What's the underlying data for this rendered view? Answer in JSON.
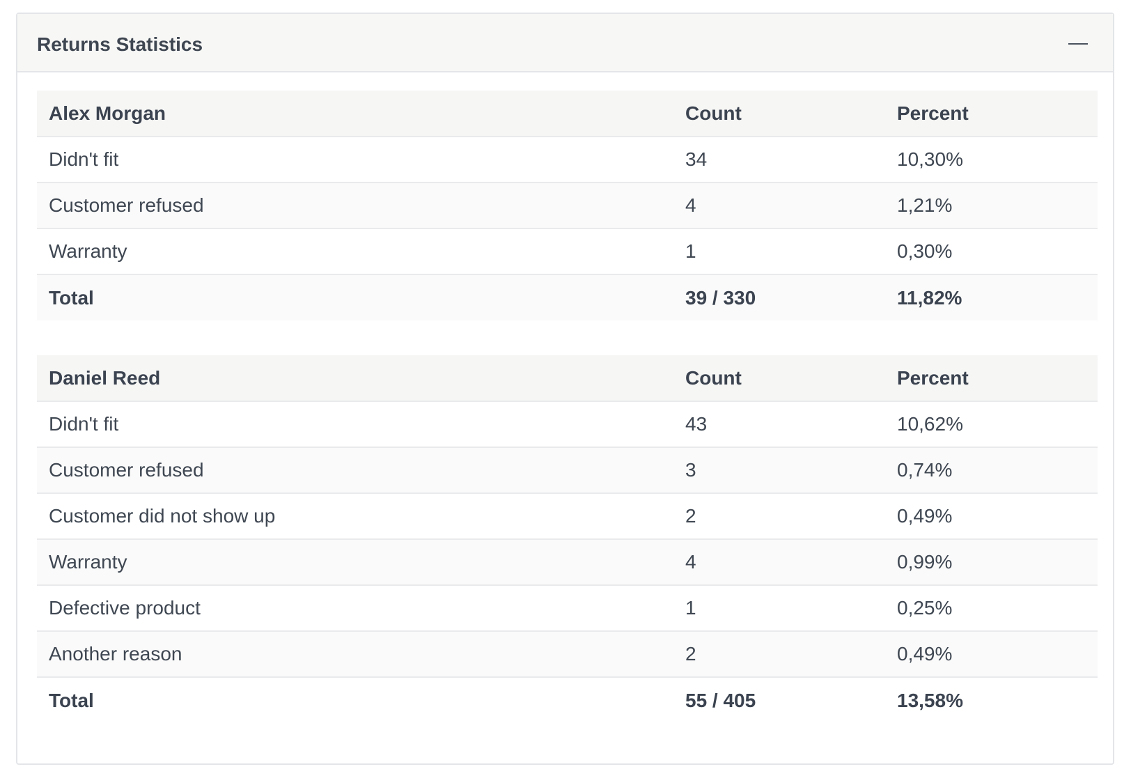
{
  "panel": {
    "title": "Returns Statistics",
    "collapse_icon": "minus-icon"
  },
  "tables": [
    {
      "person": "Alex Morgan",
      "count_header": "Count",
      "percent_header": "Percent",
      "rows": [
        {
          "reason": "Didn't fit",
          "count": "34",
          "percent": "10,30%"
        },
        {
          "reason": "Customer refused",
          "count": "4",
          "percent": "1,21%"
        },
        {
          "reason": "Warranty",
          "count": "1",
          "percent": "0,30%"
        }
      ],
      "total": {
        "label": "Total",
        "count": "39 / 330",
        "percent": "11,82%"
      }
    },
    {
      "person": "Daniel Reed",
      "count_header": "Count",
      "percent_header": "Percent",
      "rows": [
        {
          "reason": "Didn't fit",
          "count": "43",
          "percent": "10,62%"
        },
        {
          "reason": "Customer refused",
          "count": "3",
          "percent": "0,74%"
        },
        {
          "reason": "Customer did not show up",
          "count": "2",
          "percent": "0,49%"
        },
        {
          "reason": "Warranty",
          "count": "4",
          "percent": "0,99%"
        },
        {
          "reason": "Defective product",
          "count": "1",
          "percent": "0,25%"
        },
        {
          "reason": "Another reason",
          "count": "2",
          "percent": "0,49%"
        }
      ],
      "total": {
        "label": "Total",
        "count": "55 / 405",
        "percent": "13,58%"
      }
    }
  ]
}
